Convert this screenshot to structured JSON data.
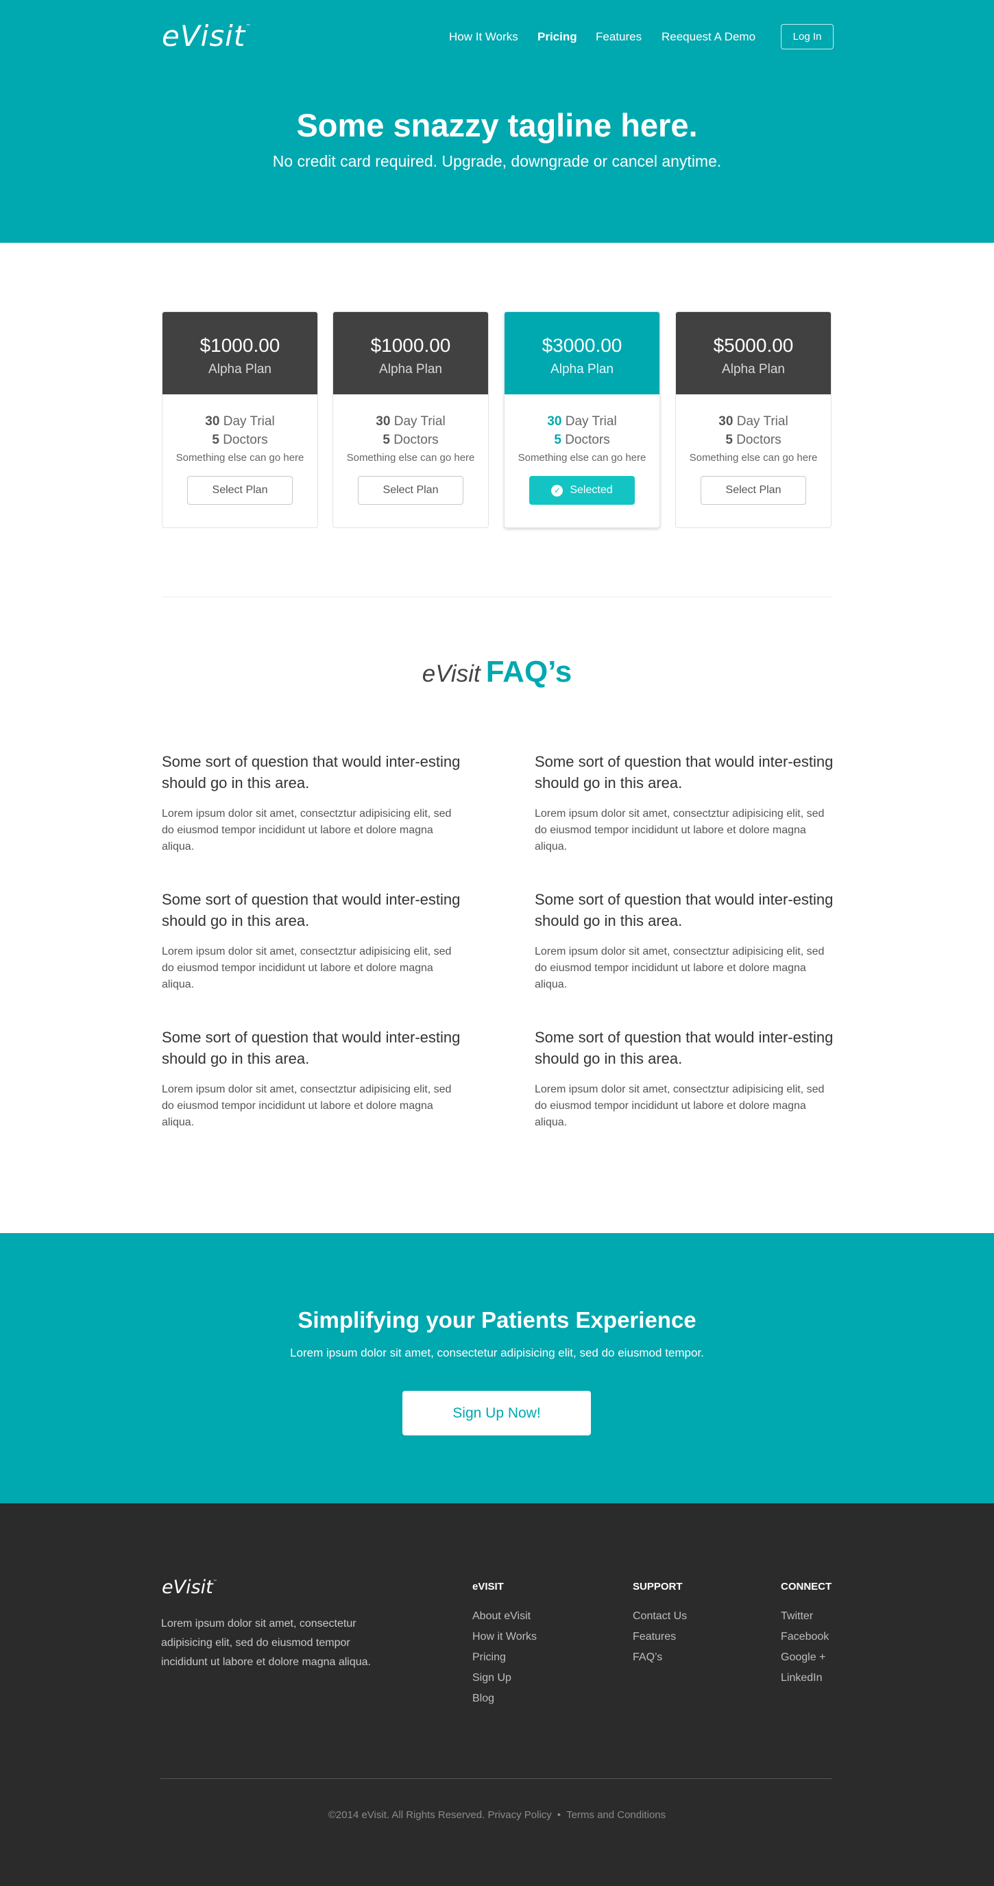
{
  "header": {
    "logo": "eVisit",
    "logo_tm": "™",
    "nav": [
      {
        "label": "How It Works"
      },
      {
        "label": "Pricing"
      },
      {
        "label": "Features"
      },
      {
        "label": "Reequest A Demo"
      }
    ],
    "login_label": "Log In"
  },
  "hero": {
    "title": "Some snazzy tagline here.",
    "subtitle": "No credit card required. Upgrade, downgrade or cancel anytime."
  },
  "plans": [
    {
      "price": "$1000.00",
      "name": "Alpha Plan",
      "trial_num": "30",
      "trial_label": "Day Trial",
      "doctors_num": "5",
      "doctors_label": "Doctors",
      "note": "Something else can go here",
      "button": "Select Plan",
      "selected": false
    },
    {
      "price": "$1000.00",
      "name": "Alpha Plan",
      "trial_num": "30",
      "trial_label": "Day Trial",
      "doctors_num": "5",
      "doctors_label": "Doctors",
      "note": "Something else can go here",
      "button": "Select Plan",
      "selected": false
    },
    {
      "price": "$3000.00",
      "name": "Alpha Plan",
      "trial_num": "30",
      "trial_label": "Day Trial",
      "doctors_num": "5",
      "doctors_label": "Doctors",
      "note": "Something else can go here",
      "button": "Selected",
      "selected": true
    },
    {
      "price": "$5000.00",
      "name": "Alpha Plan",
      "trial_num": "30",
      "trial_label": "Day Trial",
      "doctors_num": "5",
      "doctors_label": "Doctors",
      "note": "Something else can go here",
      "button": "Select Plan",
      "selected": false
    }
  ],
  "faq": {
    "title_light": "eVisit",
    "title_strong": "FAQ’s",
    "items": [
      {
        "question": "Some sort of question that would inter-esting should go in this area.",
        "answer": "Lorem ipsum dolor sit amet, consectztur adipisicing elit, sed do eiusmod tempor incididunt ut labore et dolore magna aliqua."
      },
      {
        "question": "Some sort of question that would inter-esting should go in this area.",
        "answer": "Lorem ipsum dolor sit amet, consectztur adipisicing elit, sed do eiusmod tempor incididunt ut labore et dolore magna aliqua."
      },
      {
        "question": "Some sort of question that would inter-esting should go in this area.",
        "answer": "Lorem ipsum dolor sit amet, consectztur adipisicing elit, sed do eiusmod tempor incididunt ut labore et dolore magna aliqua."
      },
      {
        "question": "Some sort of question that would inter-esting should go in this area.",
        "answer": "Lorem ipsum dolor sit amet, consectztur adipisicing elit, sed do eiusmod tempor incididunt ut labore et dolore magna aliqua."
      },
      {
        "question": "Some sort of question that would inter-esting should go in this area.",
        "answer": "Lorem ipsum dolor sit amet, consectztur adipisicing elit, sed do eiusmod tempor incididunt ut labore et dolore magna aliqua."
      },
      {
        "question": "Some sort of question that would inter-esting should go in this area.",
        "answer": "Lorem ipsum dolor sit amet, consectztur adipisicing elit, sed do eiusmod tempor incididunt ut labore et dolore magna aliqua."
      }
    ]
  },
  "cta": {
    "title": "Simplifying your Patients Experience",
    "text": "Lorem ipsum dolor sit amet, consectetur adipisicing elit, sed do eiusmod tempor.",
    "button": "Sign Up Now!"
  },
  "footer": {
    "logo": "eVisit",
    "logo_tm": "™",
    "about": "Lorem ipsum dolor sit amet, consectetur adipisicing elit, sed do eiusmod tempor incididunt ut labore et dolore magna aliqua.",
    "columns": [
      {
        "heading": "eVISIT",
        "links": [
          "About eVisit",
          "How it Works",
          "Pricing",
          "Sign Up",
          "Blog"
        ]
      },
      {
        "heading": "SUPPORT",
        "links": [
          "Contact Us",
          "Features",
          "FAQ’s"
        ]
      },
      {
        "heading": "CONNECT",
        "links": [
          "Twitter",
          "Facebook",
          "Google +",
          "LinkedIn"
        ]
      }
    ],
    "copyright": "©2014 eVisit. All Rights Reserved.",
    "privacy": "Privacy Policy",
    "separator": "•",
    "terms": "Terms and Conditions"
  },
  "colors": {
    "brand": "#00a8b0",
    "selected_button": "#14c4c4",
    "plan_header": "#414141",
    "footer_bg": "#2b2b2b"
  },
  "icons": {
    "selected": "check-circle-icon"
  }
}
